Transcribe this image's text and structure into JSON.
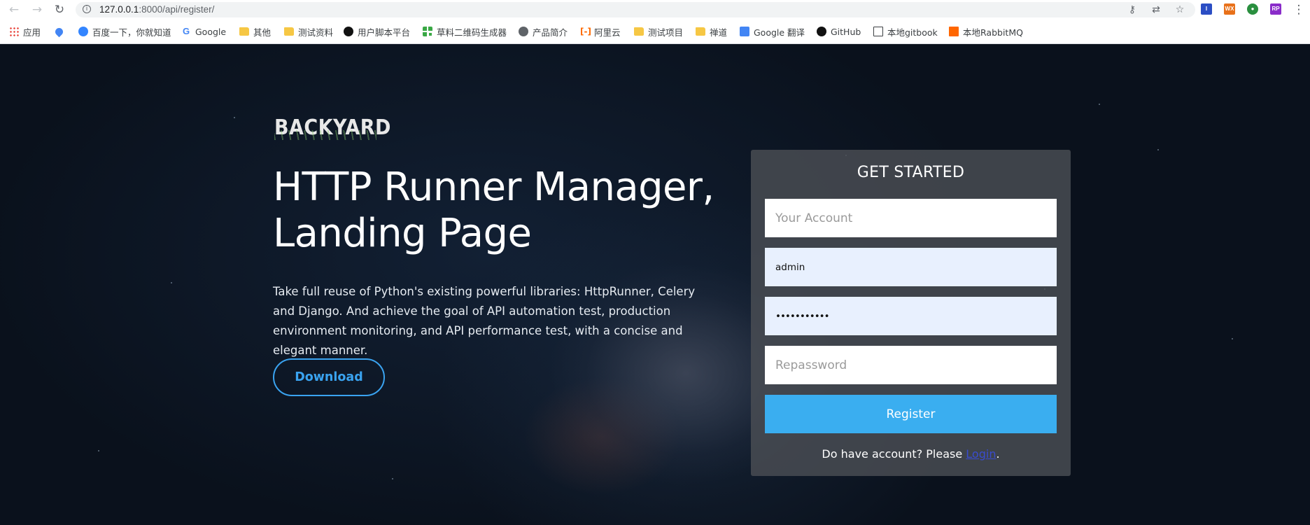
{
  "browser": {
    "url_host": "127.0.0.1",
    "url_path": ":8000/api/register/",
    "bookmarks": [
      {
        "label": "应用",
        "icon": "apps-grid-icon"
      },
      {
        "label": "",
        "icon": "maps-pin-icon"
      },
      {
        "label": "百度一下，你就知道",
        "icon": "baidu-paw-icon"
      },
      {
        "label": "Google",
        "icon": "google-icon"
      },
      {
        "label": "其他",
        "icon": "folder-icon"
      },
      {
        "label": "测试资料",
        "icon": "folder-icon"
      },
      {
        "label": "用户脚本平台",
        "icon": "userscript-icon"
      },
      {
        "label": "草料二维码生成器",
        "icon": "qr-code-icon"
      },
      {
        "label": "产品简介",
        "icon": "globe-icon"
      },
      {
        "label": "阿里云",
        "icon": "aliyun-icon"
      },
      {
        "label": "测试项目",
        "icon": "folder-icon"
      },
      {
        "label": "禅道",
        "icon": "folder-icon"
      },
      {
        "label": "Google 翻译",
        "icon": "google-translate-icon"
      },
      {
        "label": "GitHub",
        "icon": "github-icon"
      },
      {
        "label": "本地gitbook",
        "icon": "book-icon"
      },
      {
        "label": "本地RabbitMQ",
        "icon": "rabbitmq-icon"
      }
    ]
  },
  "hero": {
    "logo_text": "BACKYARD",
    "headline_line1": "HTTP Runner Manager,",
    "headline_line2": "Landing Page",
    "description": "Take full reuse of Python's existing powerful libraries: HttpRunner, Celery and Django. And achieve the goal of API automation test, production environment monitoring, and API performance test, with a concise and elegant manner.",
    "download_label": "Download"
  },
  "form": {
    "title": "GET STARTED",
    "account_placeholder": "Your Account",
    "username_value": "admin",
    "password_value": "•••••••••••",
    "repassword_placeholder": "Repassword",
    "register_label": "Register",
    "login_prompt": "Do have account? Please ",
    "login_link": "Login",
    "login_suffix": "."
  },
  "colors": {
    "accent": "#3aaef0",
    "link": "#3a4ccf",
    "panel": "#4a4e54",
    "background": "#0d1521"
  }
}
